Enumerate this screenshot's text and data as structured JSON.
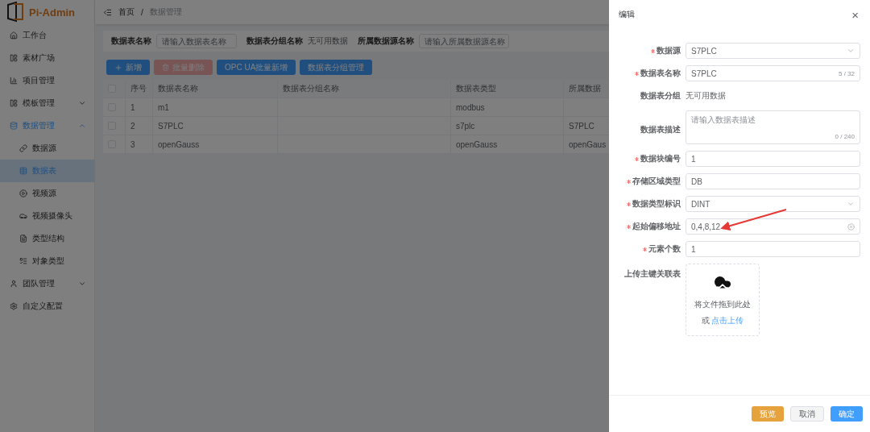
{
  "app": {
    "logo": "Pi-Admin"
  },
  "sidebar": {
    "items": [
      {
        "label": "工作台",
        "selected": false
      },
      {
        "label": "素材广场",
        "selected": false
      },
      {
        "label": "项目管理",
        "selected": false
      },
      {
        "label": "模板管理",
        "selected": false,
        "expanded": false
      },
      {
        "label": "数据管理",
        "selected": false,
        "expanded": true,
        "children": [
          {
            "label": "数据源",
            "selected": false
          },
          {
            "label": "数据表",
            "selected": true
          },
          {
            "label": "视频源",
            "selected": false
          },
          {
            "label": "视频摄像头",
            "selected": false
          },
          {
            "label": "类型结构",
            "selected": false
          },
          {
            "label": "对象类型",
            "selected": false
          }
        ]
      },
      {
        "label": "团队管理",
        "selected": false,
        "expanded": false
      },
      {
        "label": "自定义配置",
        "selected": false
      }
    ]
  },
  "breadcrumb": {
    "items": [
      "首页",
      "数据管理"
    ],
    "separator": "/"
  },
  "search": [
    {
      "kind": "input",
      "label": "数据表名称",
      "placeholder": "请输入数据表名称"
    },
    {
      "kind": "text",
      "label": "数据表分组名称",
      "value": "无可用数据"
    },
    {
      "kind": "input",
      "label": "所属数据源名称",
      "placeholder": "请输入所属数据源名称"
    }
  ],
  "toolbar": [
    {
      "label": "新增",
      "kind": "primary",
      "disabled": false
    },
    {
      "label": "批量删除",
      "kind": "danger",
      "disabled": true
    },
    {
      "label": "OPC UA批量新增",
      "kind": "primary",
      "disabled": false
    },
    {
      "label": "数据表分组管理",
      "kind": "primary",
      "disabled": false
    }
  ],
  "table": {
    "header_checked": false,
    "columns": [
      "序号",
      "数据表名称",
      "数据表分组名称",
      "数据表类型",
      "所属数据"
    ],
    "rows": [
      {
        "checked": false,
        "cells": [
          "1",
          "m1",
          null,
          "modbus",
          null
        ]
      },
      {
        "checked": false,
        "cells": [
          "2",
          "S7PLC",
          null,
          "s7plc",
          "S7PLC"
        ]
      },
      {
        "checked": false,
        "cells": [
          "3",
          "openGauss",
          null,
          "openGauss",
          "openGaus"
        ]
      }
    ]
  },
  "drawer": {
    "title": "编辑",
    "close": "×",
    "fields": [
      {
        "kind": "select",
        "label": "数据源",
        "required": true,
        "value": "S7PLC"
      },
      {
        "kind": "input",
        "label": "数据表名称",
        "required": true,
        "value": "S7PLC",
        "count": "5 / 32"
      },
      {
        "kind": "text",
        "label": "数据表分组",
        "required": false,
        "value": "无可用数据"
      },
      {
        "kind": "textarea",
        "label": "数据表描述",
        "required": false,
        "placeholder": "请输入数据表描述",
        "count": "0 / 240"
      },
      {
        "kind": "input",
        "label": "数据块编号",
        "required": true,
        "value": "1"
      },
      {
        "kind": "input",
        "label": "存储区域类型",
        "required": true,
        "value": "DB"
      },
      {
        "kind": "select",
        "label": "数据类型标识",
        "required": true,
        "value": "DINT"
      },
      {
        "kind": "clearable",
        "label": "起始偏移地址",
        "required": true,
        "value": "0,4,8,12"
      },
      {
        "kind": "input",
        "label": "元素个数",
        "required": true,
        "value": "1"
      },
      {
        "kind": "upload",
        "label": "上传主键关联表",
        "required": false,
        "hint": "将文件拖到此处",
        "prefix": "或",
        "link": "点击上传"
      }
    ],
    "buttons": [
      {
        "label": "预览",
        "kind": "warning"
      },
      {
        "label": "取消",
        "kind": "default"
      },
      {
        "label": "确定",
        "kind": "primary"
      }
    ]
  }
}
